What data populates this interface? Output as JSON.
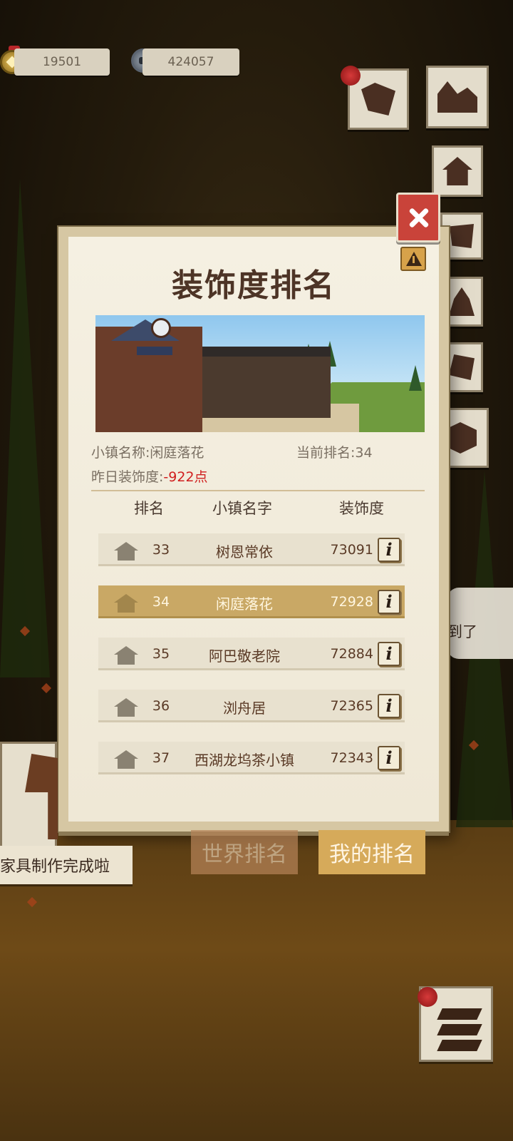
{
  "currency": {
    "gold_value": "19501",
    "stone_value": "424057"
  },
  "panel": {
    "title": "装饰度排名",
    "town_name_label": "小镇名称:",
    "town_name_value": "闲庭落花",
    "current_rank_label": "当前排名:",
    "current_rank_value": "34",
    "yesterday_label": "昨日装饰度:",
    "yesterday_value": "-922点",
    "columns": {
      "rank": "排名",
      "name": "小镇名字",
      "decoration": "装饰度"
    },
    "rows": [
      {
        "rank": "33",
        "name": "树恩常依",
        "score": "73091",
        "info": "i"
      },
      {
        "rank": "34",
        "name": "闲庭落花",
        "score": "72928",
        "info": "i",
        "highlight": true
      },
      {
        "rank": "35",
        "name": "阿巴敬老院",
        "score": "72884",
        "info": "i"
      },
      {
        "rank": "36",
        "name": "浏舟居",
        "score": "72365",
        "info": "i"
      },
      {
        "rank": "37",
        "name": "西湖龙坞茶小镇",
        "score": "72343",
        "info": "i"
      }
    ]
  },
  "tabs": {
    "world": "世界排名",
    "mine": "我的排名"
  },
  "notification": {
    "text": "家具制作完成啦"
  },
  "bubble": {
    "text": "到了"
  },
  "colors": {
    "highlight_row": "#c9a865",
    "negative": "#d01f1f",
    "title": "#4d3426",
    "close_button": "#c9433a"
  },
  "icons": [
    "gold-coin-icon",
    "stone-icon",
    "map-scroll-icon",
    "town-icon",
    "house-icon",
    "quest-icon",
    "campfire-icon",
    "dice-icon",
    "crate-icon",
    "close-icon",
    "warning-icon",
    "info-icon",
    "layers-icon"
  ]
}
